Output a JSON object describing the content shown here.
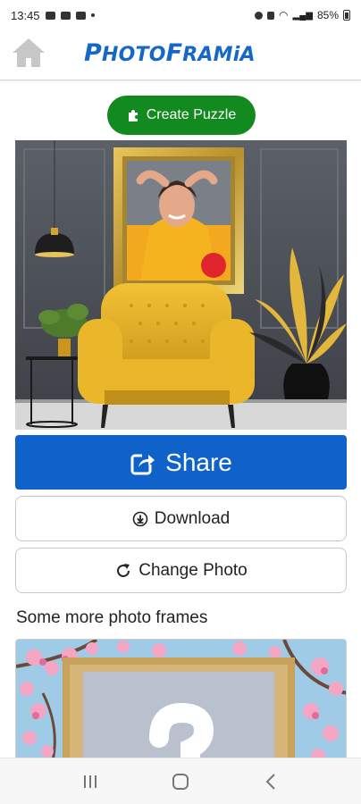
{
  "status_bar": {
    "time": "13:45",
    "battery": "85%"
  },
  "header": {
    "logo_text_p": "P",
    "logo_text_hoto": "HOTO",
    "logo_text_f": "F",
    "logo_text_rami": "RAMi",
    "logo_text_a": "A"
  },
  "actions": {
    "create_puzzle_label": "Create Puzzle",
    "share_label": "Share",
    "download_label": "Download",
    "change_photo_label": "Change Photo"
  },
  "more_frames": {
    "title": "Some more photo frames"
  },
  "colors": {
    "brand_blue": "#1668c8",
    "share_blue": "#0f62c9",
    "puzzle_green": "#128a1f"
  },
  "icons": {
    "home": "home-icon",
    "puzzle": "puzzle-icon",
    "share": "share-icon",
    "download": "download-icon",
    "refresh": "refresh-icon",
    "nav_recents": "recents-icon",
    "nav_home": "nav-home-icon",
    "nav_back": "back-icon"
  }
}
